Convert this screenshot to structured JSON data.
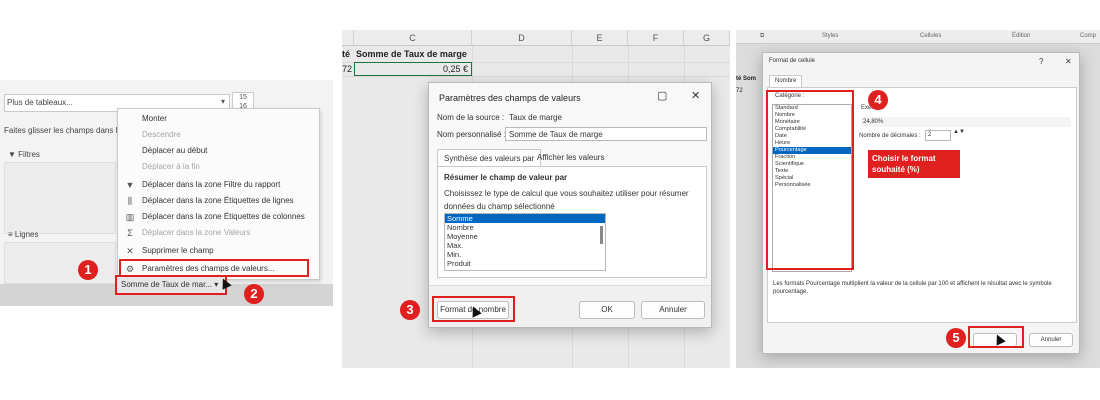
{
  "colors": {
    "accent": "#e01f1f",
    "selection": "#0067c0"
  },
  "panel1": {
    "combo_value": "Plus de tableaux...",
    "row_numbers": [
      "15",
      "16"
    ],
    "drag_hint": "Faites glisser les champs dans l",
    "filters_label": "Filtres",
    "rows_label": "Lignes",
    "menu": [
      {
        "label": "Monter",
        "enabled": true,
        "icon": ""
      },
      {
        "label": "Descendre",
        "enabled": false,
        "icon": ""
      },
      {
        "label": "Déplacer au début",
        "enabled": true,
        "icon": ""
      },
      {
        "label": "Déplacer à la fin",
        "enabled": false,
        "icon": ""
      },
      {
        "label": "Déplacer dans la zone Filtre du rapport",
        "enabled": true,
        "icon": "filter-icon"
      },
      {
        "label": "Déplacer dans la zone Étiquettes de lignes",
        "enabled": true,
        "icon": "rows-icon"
      },
      {
        "label": "Déplacer dans la zone Étiquettes de colonnes",
        "enabled": true,
        "icon": "columns-icon"
      },
      {
        "label": "Déplacer dans la zone Valeurs",
        "enabled": false,
        "icon": "sigma-icon"
      },
      {
        "label": "Supprimer le champ",
        "enabled": true,
        "icon": "close-icon"
      },
      {
        "label": "Paramètres des champs de valeurs...",
        "enabled": true,
        "icon": "settings-icon"
      }
    ],
    "field_pill": "Somme de Taux de mar...",
    "badge1": "1",
    "badge2": "2"
  },
  "panel2": {
    "columns": [
      "C",
      "D",
      "E",
      "F",
      "G"
    ],
    "header_cell_left": "té",
    "header_cell": "Somme de Taux de marge",
    "row_left": "72",
    "value_cell": "0,25 €",
    "dialog": {
      "title": "Paramètres des champs de valeurs",
      "source_label": "Nom de la source :",
      "source_value": "Taux de marge",
      "custom_label": "Nom personnalisé :",
      "custom_value": "Somme de Taux de marge",
      "tab_active": "Synthèse des valeurs par",
      "tab_other": "Afficher les valeurs",
      "section_title": "Résumer le champ de valeur par",
      "description_line1": "Choisissez le type de calcul que vous souhaitez utiliser pour résumer",
      "description_line2": "données du champ sélectionné",
      "options": [
        "Somme",
        "Nombre",
        "Moyenne",
        "Max.",
        "Min.",
        "Produit"
      ],
      "selected_option": "Somme",
      "format_button": "Format de nombre",
      "ok_button": "OK",
      "cancel_button": "Annuler",
      "minimize": "▢",
      "close": "✕"
    },
    "badge3": "3"
  },
  "panel3": {
    "ribbon": [
      "Styles",
      "Cellules",
      "Édition",
      "Comp"
    ],
    "behind_left": "té Som",
    "behind_row": "72",
    "dialog": {
      "title": "Format de cellule",
      "help": "?",
      "close": "✕",
      "tab": "Nombre",
      "category_label": "Catégorie :",
      "categories": [
        "Standard",
        "Nombre",
        "Monétaire",
        "Comptabilité",
        "Date",
        "Heure",
        "Pourcentage",
        "Fraction",
        "Scientifique",
        "Texte",
        "Spécial",
        "Personnalisée"
      ],
      "selected_category": "Pourcentage",
      "example_label": "Exemple",
      "example_value": "24,80%",
      "decimals_label": "Nombre de décimales :",
      "decimals_value": "2",
      "footer_text_1": "Les formats Pourcentage multiplient la valeur de la cellule par 100 et affichent le résultat avec le symbole",
      "footer_text_2": "pourcentage.",
      "cancel_button": "Annuler"
    },
    "callout": "Choisir le format souhaité (%)",
    "badge4": "4",
    "badge5": "5"
  }
}
